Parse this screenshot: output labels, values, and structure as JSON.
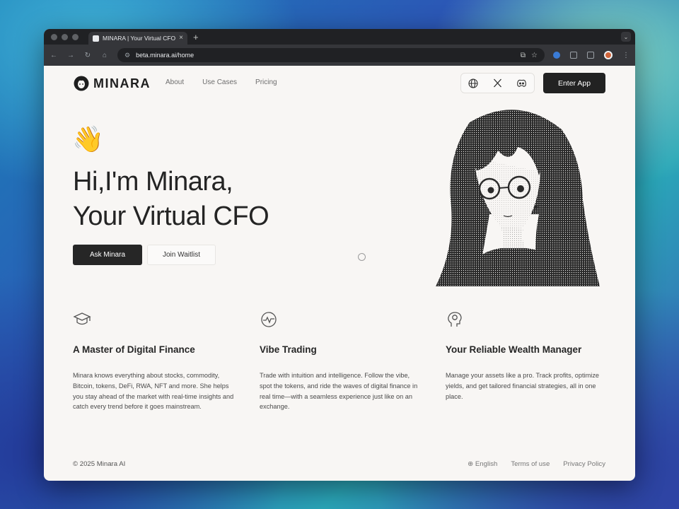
{
  "browser": {
    "tab_title": "MINARA | Your Virtual CFO for",
    "tab_close": "×",
    "new_tab": "+",
    "tab_menu": "⌄",
    "url": "beta.minara.ai/home",
    "nav_back": "←",
    "nav_forward": "→",
    "nav_reload": "↻",
    "nav_home": "⌂"
  },
  "site": {
    "logo_text": "MINARA",
    "nav": [
      "About",
      "Use Cases",
      "Pricing"
    ],
    "social_icons": [
      "globe-icon",
      "x-logo-icon",
      "discord-icon"
    ],
    "enter_app": "Enter App"
  },
  "hero": {
    "emoji": "👋",
    "title_line1": "Hi,I'm Minara,",
    "title_line2": "Your Virtual CFO",
    "primary_button": "Ask Minara",
    "secondary_button": "Join Waitlist"
  },
  "features": [
    {
      "icon": "graduation-cap-icon",
      "title": "A Master of Digital Finance",
      "desc": "Minara knows everything about stocks, commodity, Bitcoin, tokens, DeFi, RWA, NFT and more. She helps you stay ahead of the market with real-time insights and catch every trend before it goes mainstream."
    },
    {
      "icon": "pulse-icon",
      "title": "Vibe Trading",
      "desc": "Trade with intuition and intelligence. Follow the vibe, spot the tokens, and ride the waves of digital finance in real time—with a seamless experience just like on an exchange."
    },
    {
      "icon": "head-brain-icon",
      "title": "Your Reliable Wealth Manager",
      "desc": "Manage your assets like a pro. Track profits, optimize yields, and get tailored financial strategies, all in one place."
    }
  ],
  "footer": {
    "copyright": "© 2025 Minara AI",
    "language": "English",
    "terms": "Terms of use",
    "privacy": "Privacy Policy"
  },
  "colors": {
    "page_bg": "#f8f6f4",
    "primary_button": "#262626",
    "text": "#242424"
  }
}
